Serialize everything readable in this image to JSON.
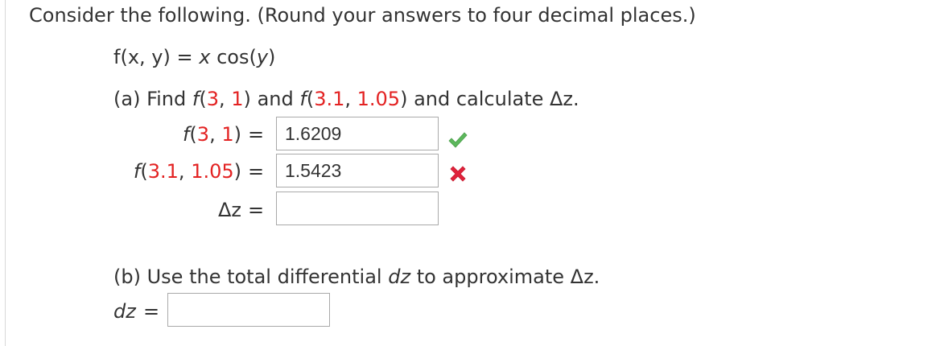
{
  "problem": {
    "intro": "Consider the following. (Round your answers to four decimal places.)",
    "function": {
      "lhs_f": "f",
      "lhs_args": "(x, y)",
      "eq": "=",
      "rhs_x": "x",
      "rhs_cos": "cos(",
      "rhs_y": "y",
      "rhs_close": ")"
    }
  },
  "part_a": {
    "label": "(a)",
    "text_find": "Find",
    "f1_fn": "f",
    "f1_open": "(",
    "f1_a": "3",
    "f1_comma": ", ",
    "f1_b": "1",
    "f1_close": ")",
    "and_text": "and",
    "f2_fn": "f",
    "f2_open": "(",
    "f2_a": "3.1",
    "f2_comma": ", ",
    "f2_b": "1.05",
    "f2_close": ")",
    "calc_text": "and calculate Δz.",
    "rows": [
      {
        "label_fn": "f",
        "label_open": "(",
        "label_a": "3",
        "label_comma": ", ",
        "label_b": "1",
        "label_close": ")",
        "eq": "=",
        "value": "1.6209",
        "status": "correct"
      },
      {
        "label_fn": "f",
        "label_open": "(",
        "label_a": "3.1",
        "label_comma": ", ",
        "label_b": "1.05",
        "label_close": ")",
        "eq": "=",
        "value": "1.5423",
        "status": "incorrect"
      },
      {
        "label": "Δz",
        "eq": "=",
        "value": "",
        "status": "none"
      }
    ]
  },
  "part_b": {
    "label": "(b)",
    "text_before": "Use the total differential",
    "dz": "dz",
    "text_after": "to approximate Δz.",
    "row": {
      "label": "dz",
      "eq": "=",
      "value": ""
    }
  },
  "colors": {
    "text": "#333333",
    "highlight": "#e32222",
    "correct": "#5cb85c",
    "incorrect": "#e0223b",
    "box_border": "#a9a9a9"
  },
  "icons": {
    "correct": "checkmark-icon",
    "incorrect": "x-mark-icon"
  }
}
